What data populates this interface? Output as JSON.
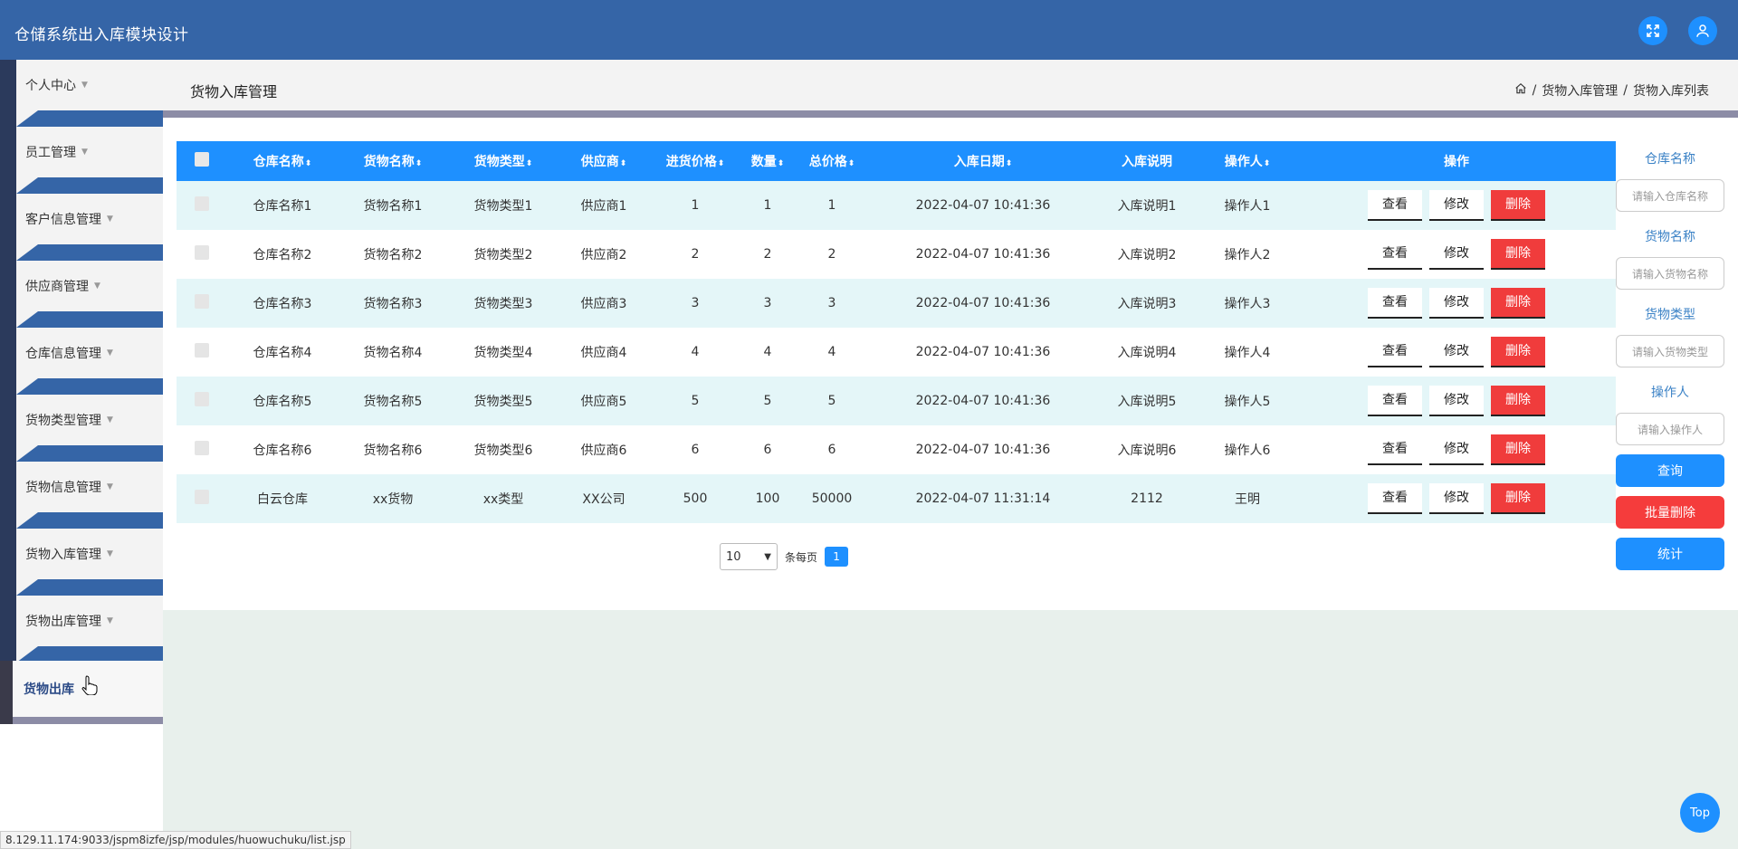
{
  "header": {
    "title": "仓储系统出入库模块设计"
  },
  "sidebar": {
    "items": [
      {
        "label": "个人中心"
      },
      {
        "label": "员工管理"
      },
      {
        "label": "客户信息管理"
      },
      {
        "label": "供应商管理"
      },
      {
        "label": "仓库信息管理"
      },
      {
        "label": "货物类型管理"
      },
      {
        "label": "货物信息管理"
      },
      {
        "label": "货物入库管理"
      },
      {
        "label": "货物出库管理"
      }
    ],
    "active": {
      "label": "货物出库"
    }
  },
  "page": {
    "title": "货物入库管理",
    "breadcrumb": [
      "货物入库管理",
      "货物入库列表"
    ],
    "sep": "/"
  },
  "table": {
    "headers": [
      "仓库名称",
      "货物名称",
      "货物类型",
      "供应商",
      "进货价格",
      "数量",
      "总价格",
      "入库日期",
      "入库说明",
      "操作人",
      "操作"
    ],
    "sort_glyph": "⬍",
    "rows": [
      [
        "仓库名称1",
        "货物名称1",
        "货物类型1",
        "供应商1",
        "1",
        "1",
        "1",
        "2022-04-07 10:41:36",
        "入库说明1",
        "操作人1"
      ],
      [
        "仓库名称2",
        "货物名称2",
        "货物类型2",
        "供应商2",
        "2",
        "2",
        "2",
        "2022-04-07 10:41:36",
        "入库说明2",
        "操作人2"
      ],
      [
        "仓库名称3",
        "货物名称3",
        "货物类型3",
        "供应商3",
        "3",
        "3",
        "3",
        "2022-04-07 10:41:36",
        "入库说明3",
        "操作人3"
      ],
      [
        "仓库名称4",
        "货物名称4",
        "货物类型4",
        "供应商4",
        "4",
        "4",
        "4",
        "2022-04-07 10:41:36",
        "入库说明4",
        "操作人4"
      ],
      [
        "仓库名称5",
        "货物名称5",
        "货物类型5",
        "供应商5",
        "5",
        "5",
        "5",
        "2022-04-07 10:41:36",
        "入库说明5",
        "操作人5"
      ],
      [
        "仓库名称6",
        "货物名称6",
        "货物类型6",
        "供应商6",
        "6",
        "6",
        "6",
        "2022-04-07 10:41:36",
        "入库说明6",
        "操作人6"
      ],
      [
        "白云仓库",
        "xx货物",
        "xx类型",
        "XX公司",
        "500",
        "100",
        "50000",
        "2022-04-07 11:31:14",
        "2112",
        "王明"
      ]
    ],
    "actions": {
      "view": "查看",
      "edit": "修改",
      "delete": "删除"
    }
  },
  "pagination": {
    "page_size": "10",
    "per_page_label": "条每页",
    "current_page": "1"
  },
  "search": {
    "fields": [
      {
        "label": "仓库名称",
        "placeholder": "请输入仓库名称"
      },
      {
        "label": "货物名称",
        "placeholder": "请输入货物名称"
      },
      {
        "label": "货物类型",
        "placeholder": "请输入货物类型"
      },
      {
        "label": "操作人",
        "placeholder": "请输入操作人"
      }
    ],
    "query_label": "查询",
    "batch_delete_label": "批量删除",
    "stats_label": "统计"
  },
  "status_url": "8.129.11.174:9033/jspm8izfe/jsp/modules/huowuchuku/list.jsp",
  "top_button": "Top",
  "colors": {
    "header": "#3565a7",
    "primary": "#1e90ff",
    "danger": "#f03c3c",
    "row_alt": "#e4f6f8"
  },
  "icons": {
    "fullscreen": "fullscreen-icon",
    "user": "user-icon",
    "home": "home-icon"
  }
}
